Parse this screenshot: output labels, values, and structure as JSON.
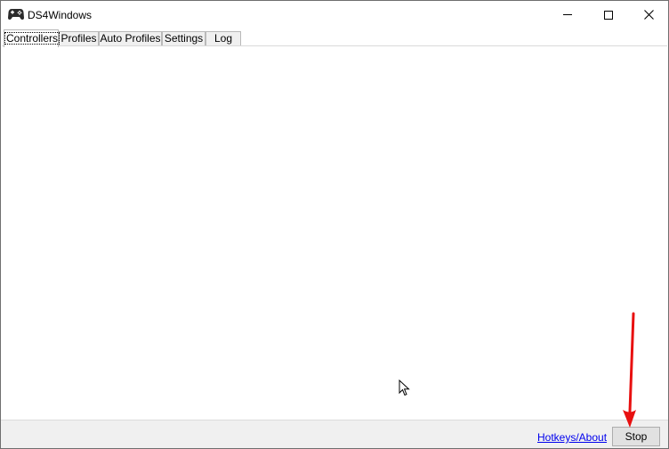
{
  "window": {
    "title": "DS4Windows",
    "icon": "gamepad-icon",
    "controls": [
      "minimize-icon",
      "maximize-icon",
      "close-icon"
    ]
  },
  "tabs": [
    {
      "label": "Controllers",
      "active": true
    },
    {
      "label": "Profiles",
      "active": false
    },
    {
      "label": "Auto Profiles",
      "active": false
    },
    {
      "label": "Settings",
      "active": false
    },
    {
      "label": "Log",
      "active": false
    }
  ],
  "statusbar": {
    "hotkeys_link": "Hotkeys/About",
    "stop_button": "Stop"
  },
  "colors": {
    "link": "#0000ee",
    "annotation_arrow": "#e81010",
    "statusbar_bg": "#f0f0f0"
  }
}
